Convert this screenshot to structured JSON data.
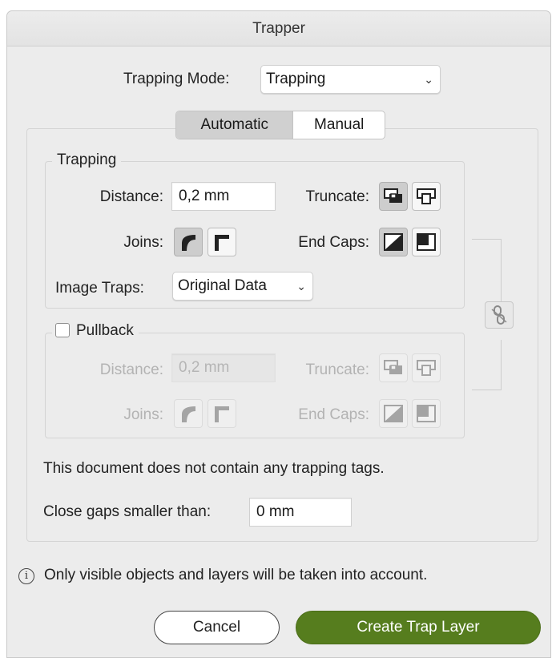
{
  "window": {
    "title": "Trapper"
  },
  "mode": {
    "label": "Trapping Mode:",
    "value": "Trapping"
  },
  "tabs": [
    {
      "label": "Automatic",
      "active": true
    },
    {
      "label": "Manual",
      "active": false
    }
  ],
  "trapping": {
    "legend": "Trapping",
    "distance_label": "Distance:",
    "distance_value": "0,2 mm",
    "truncate_label": "Truncate:",
    "joins_label": "Joins:",
    "endcaps_label": "End Caps:",
    "image_traps_label": "Image Traps:",
    "image_traps_value": "Original Data"
  },
  "pullback": {
    "legend": "Pullback",
    "checked": false,
    "distance_label": "Distance:",
    "distance_value": "0,2 mm",
    "truncate_label": "Truncate:",
    "joins_label": "Joins:",
    "endcaps_label": "End Caps:"
  },
  "messages": {
    "no_tags": "This document does not contain any trapping tags.",
    "close_gaps_label": "Close gaps smaller than:",
    "close_gaps_value": "0 mm",
    "info": "Only visible objects and layers will be taken into account."
  },
  "buttons": {
    "cancel": "Cancel",
    "create": "Create Trap Layer"
  },
  "colors": {
    "primary": "#567d1e",
    "dialog_bg": "#ececec"
  }
}
